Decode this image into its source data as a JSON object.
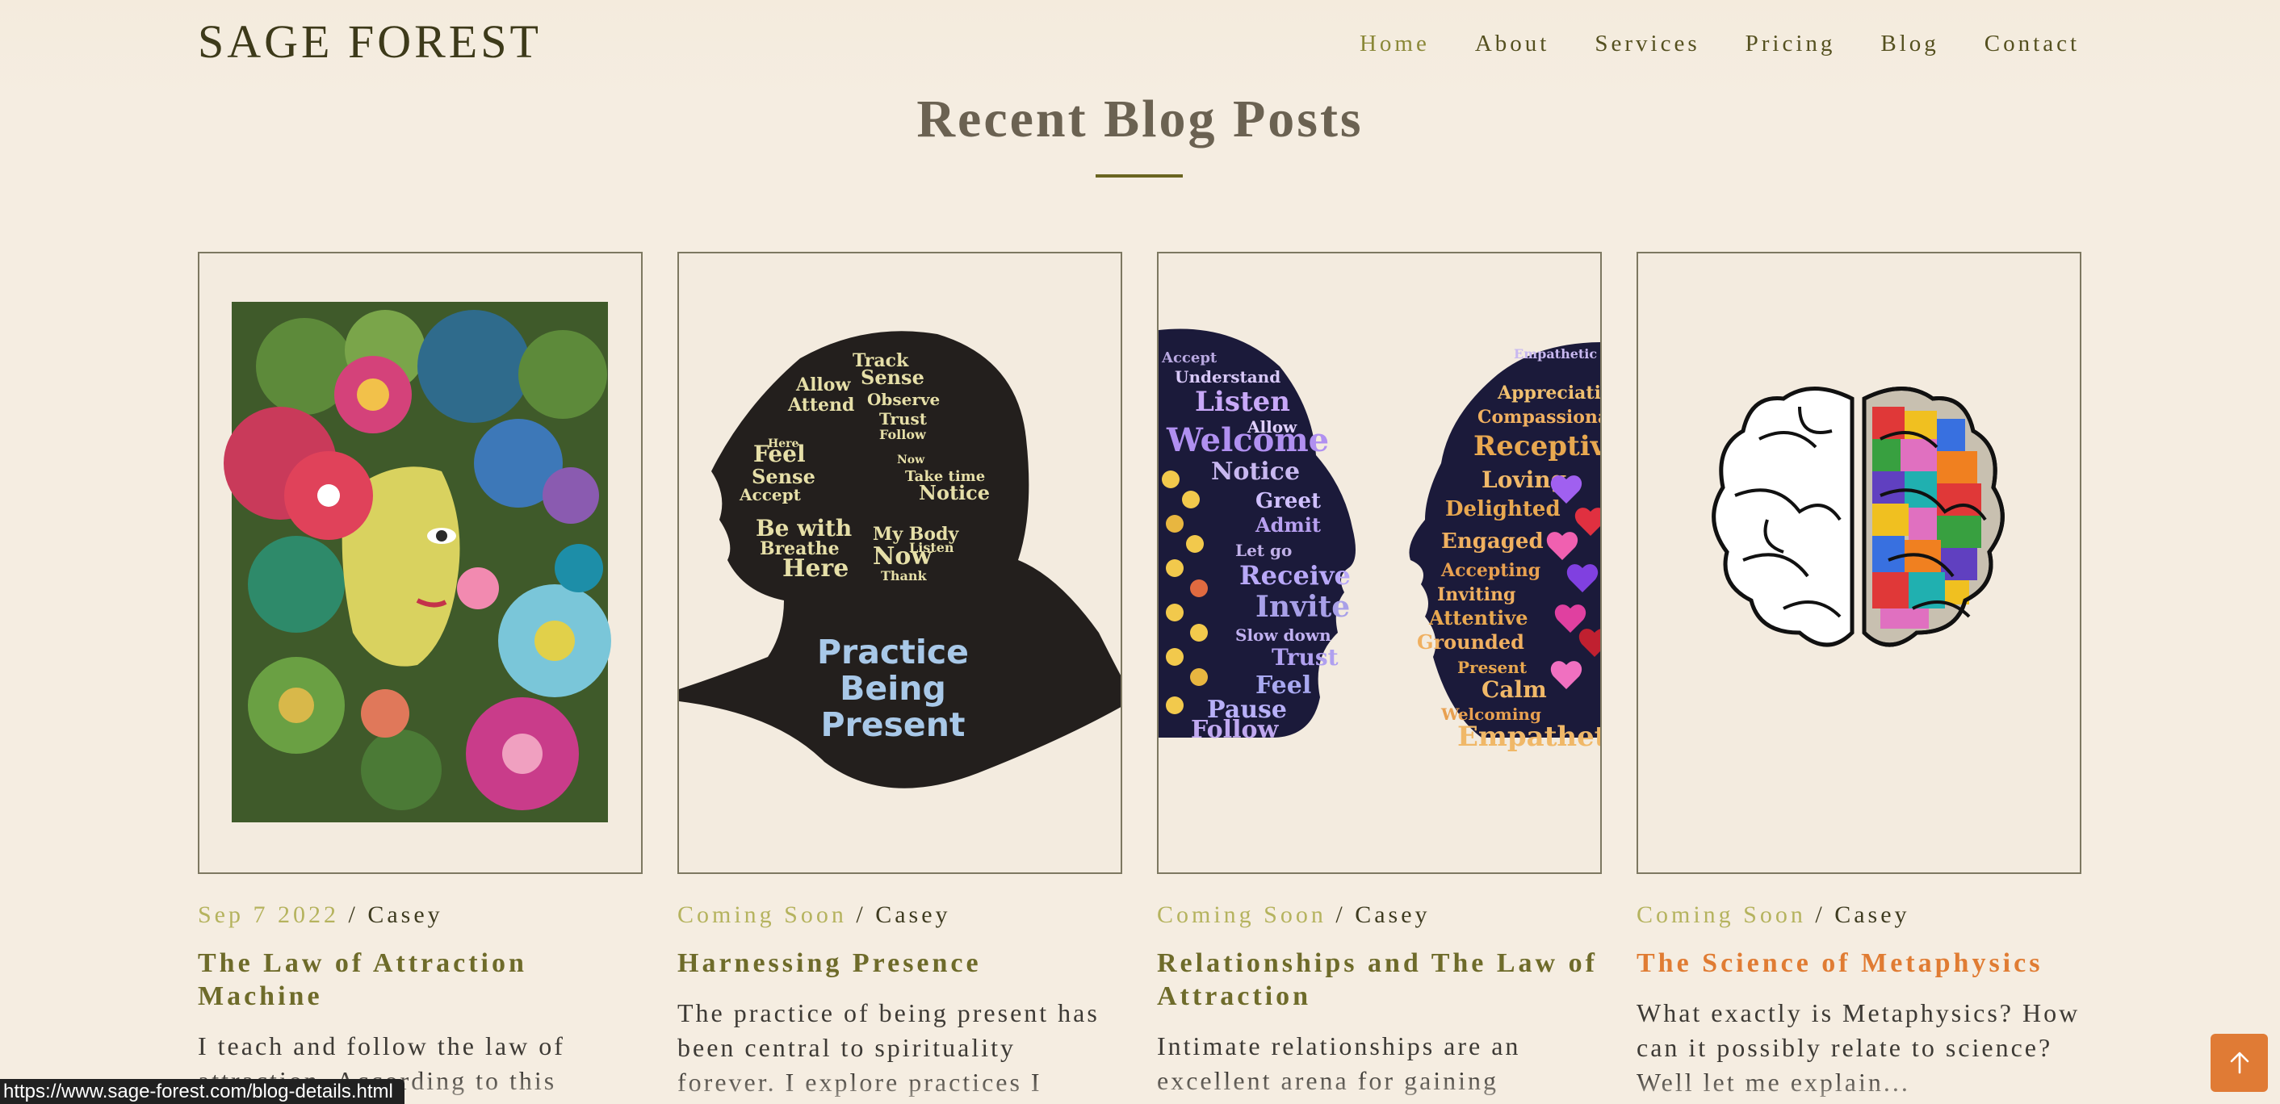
{
  "header": {
    "logo": "SAGE FOREST",
    "nav": [
      "Home",
      "About",
      "Services",
      "Pricing",
      "Blog",
      "Contact"
    ],
    "active": "Home"
  },
  "section": {
    "title": "Recent Blog Posts"
  },
  "posts": [
    {
      "date": "Sep 7 2022",
      "author": "Casey",
      "title": "The Law of Attraction Machine",
      "excerpt": "I teach and follow the law of attraction. According to this"
    },
    {
      "date": "Coming Soon",
      "author": "Casey",
      "title": "Harnessing Presence",
      "excerpt": "The practice of being present has been central to spirituality forever. I explore practices I",
      "art_text": [
        "Practice",
        "Being",
        "Present"
      ],
      "art_words": [
        "Track",
        "Allow",
        "Sense",
        "Attend",
        "Observe",
        "Trust",
        "Follow",
        "Feel",
        "Sense",
        "Accept",
        "Here",
        "Now",
        "Take time",
        "Notice",
        "Be with",
        "Breathe",
        "Here",
        "My Body",
        "Now",
        "Listen",
        "Thank"
      ]
    },
    {
      "date": "Coming Soon",
      "author": "Casey",
      "title": "Relationships and The Law of Attraction",
      "excerpt": "Intimate relationships are an excellent arena for gaining",
      "art_words_left": [
        "Accept",
        "Understand",
        "Listen",
        "Allow",
        "Welcome",
        "Notice",
        "Greet",
        "Admit",
        "Let go",
        "Receive",
        "Invite",
        "Slow down",
        "Trust",
        "Feel",
        "Pause",
        "Follow"
      ],
      "art_words_right": [
        "Empathetic",
        "Appreciative",
        "Compassionate",
        "Receptive",
        "Loving",
        "Delighted",
        "Engaged",
        "Accepting",
        "Inviting",
        "Attentive",
        "Grounded",
        "Present",
        "Calm",
        "Welcoming",
        "Empathetic"
      ]
    },
    {
      "date": "Coming Soon",
      "author": "Casey",
      "title": "The Science of Metaphysics",
      "excerpt": "What exactly is Metaphysics? How can it possibly relate to science? Well let me explain..."
    }
  ],
  "status_url": "https://www.sage-forest.com/blog-details.html",
  "colors": {
    "accent": "#e07b35",
    "olive": "#6e6b2a",
    "background": "#f5ede1"
  }
}
